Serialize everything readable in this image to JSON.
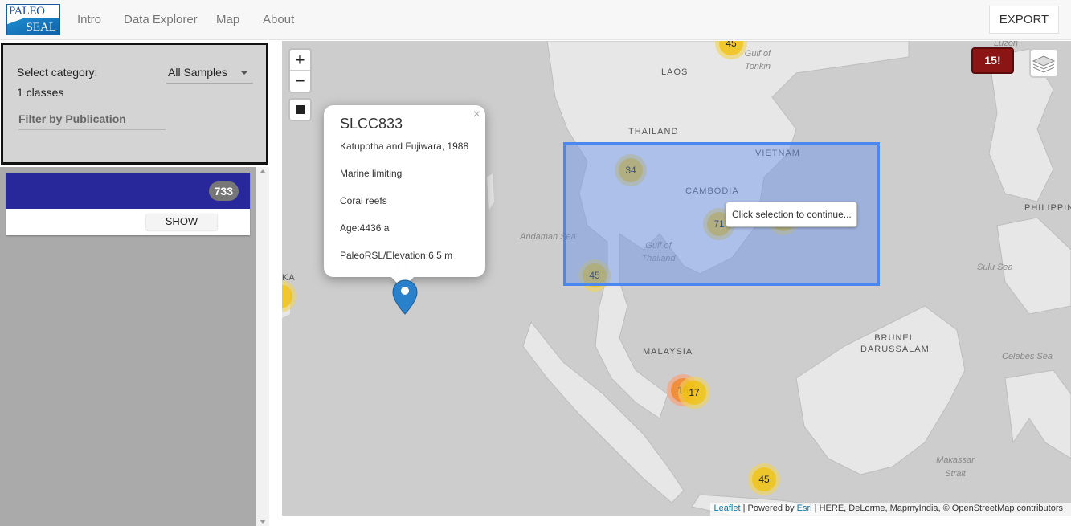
{
  "header": {
    "logo_top": "PALEO",
    "logo_bottom": "SEAL",
    "nav": [
      "Intro",
      "Data Explorer",
      "Map",
      "About"
    ],
    "export_label": "EXPORT"
  },
  "sidebar": {
    "select_label": "Select category:",
    "select_value": "All Samples",
    "classes_count": "1 classes",
    "publication_placeholder": "Filter by Publication",
    "card": {
      "count": "733",
      "show_label": "SHOW",
      "header_color": "#29289a"
    }
  },
  "map": {
    "zoom_in": "+",
    "zoom_out": "−",
    "alert_label": "15!",
    "selection_tooltip": "Click selection to continue...",
    "popup": {
      "close": "×",
      "title": "SLCC833",
      "citation": "Katupotha and Fujiwara, 1988",
      "indicator": "Marine limiting",
      "material": "Coral reefs",
      "age": "Age:4436 a",
      "elevation": "PaleoRSL/Elevation:6.5 m"
    },
    "country_labels": {
      "laos": "LAOS",
      "thailand": "THAILAND",
      "vietnam": "VIETNAM",
      "cambodia": "CAMBODIA",
      "malaysia": "MALAYSIA",
      "brunei": "BRUNEI DARUSSALAM",
      "philippines": "PHILIPPINES",
      "lanka": "KA",
      "luzon": "Luzon"
    },
    "sea_labels": {
      "tonkin": "Gulf of Tonkin",
      "andaman": "Andaman Sea",
      "thailand_gulf": "Gulf of Thailand",
      "sulu": "Sulu Sea",
      "celebes": "Celebes Sea",
      "makassar": "Makassar Strait"
    },
    "clusters": {
      "top": "45",
      "c34": "34",
      "c71": "71",
      "c45a": "45",
      "c17": "17",
      "c45b": "45",
      "c16": "16"
    },
    "attribution": {
      "leaflet": "Leaflet",
      "powered": " | Powered by ",
      "esri": "Esri",
      "rest": " | HERE, DeLorme, MapmyIndia, © OpenStreetMap contributors"
    }
  }
}
